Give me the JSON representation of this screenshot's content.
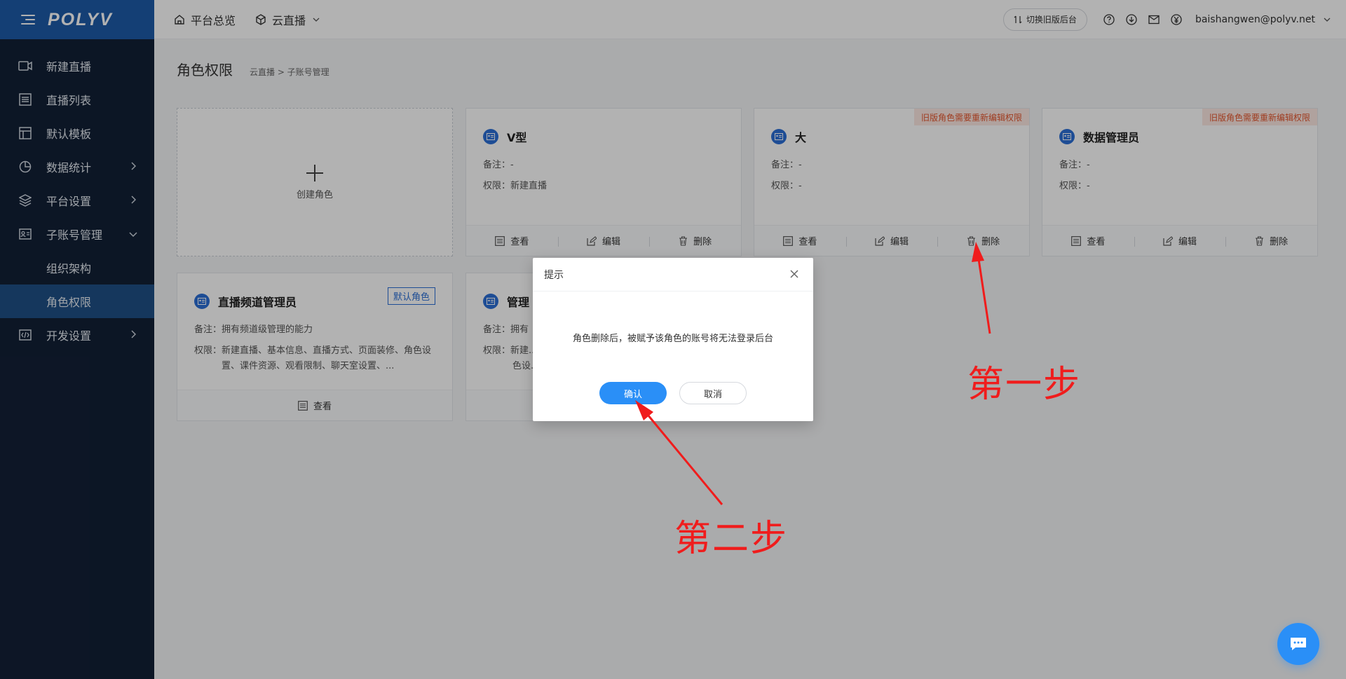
{
  "brand": {
    "logo": "POLYV"
  },
  "sidebar": {
    "items": [
      {
        "label": "新建直播",
        "icon": "video-camera-icon"
      },
      {
        "label": "直播列表",
        "icon": "list-icon"
      },
      {
        "label": "默认模板",
        "icon": "template-icon"
      },
      {
        "label": "数据统计",
        "icon": "pie-chart-icon"
      },
      {
        "label": "平台设置",
        "icon": "layers-icon"
      },
      {
        "label": "子账号管理",
        "icon": "id-card-icon"
      },
      {
        "label": "开发设置",
        "icon": "code-icon"
      }
    ],
    "sub_items": [
      {
        "label": "组织架构"
      },
      {
        "label": "角色权限"
      }
    ]
  },
  "header": {
    "overview": "平台总览",
    "cloud_live": "云直播",
    "switch_old": "切换旧版后台",
    "user_email": "baishangwen@polyv.net"
  },
  "page": {
    "title": "角色权限",
    "breadcrumb": "云直播 >  子账号管理"
  },
  "create_card": {
    "label": "创建角色"
  },
  "cards": [
    {
      "name": "V型",
      "remark_key": "备注：",
      "remark": "-",
      "perm_key": "权限：",
      "perm": "新建直播",
      "tag": ""
    },
    {
      "name": "大",
      "remark_key": "备注：",
      "remark": "-",
      "perm_key": "权限：",
      "perm": "-",
      "tag": "旧版角色需要重新编辑权限"
    },
    {
      "name": "数据管理员",
      "remark_key": "备注：",
      "remark": "-",
      "perm_key": "权限：",
      "perm": "-",
      "tag": "旧版角色需要重新编辑权限"
    },
    {
      "name": "直播频道管理员",
      "remark_key": "备注：",
      "remark": "拥有频道级管理的能力",
      "perm_key": "权限：",
      "perm": "新建直播、基本信息、直播方式、页面装修、角色设置、课件资源、观看限制、聊天室设置、...",
      "tag": "默认角色"
    },
    {
      "name": "管理",
      "remark_key": "备注：",
      "remark": "拥有",
      "perm_key": "权限：",
      "perm": "新建...",
      "perm2": "色设..."
    }
  ],
  "actions": {
    "view": "查看",
    "edit": "编辑",
    "delete": "删除"
  },
  "modal": {
    "title": "提示",
    "message": "角色删除后，被赋予该角色的账号将无法登录后台",
    "ok": "确认",
    "cancel": "取消"
  },
  "annotations": {
    "step1": "第一步",
    "step2": "第二步"
  },
  "colors": {
    "sidebar": "#122036",
    "logo_bar": "#1e5ba8",
    "primary": "#2a8ff7",
    "annotation": "#f01c1c"
  }
}
